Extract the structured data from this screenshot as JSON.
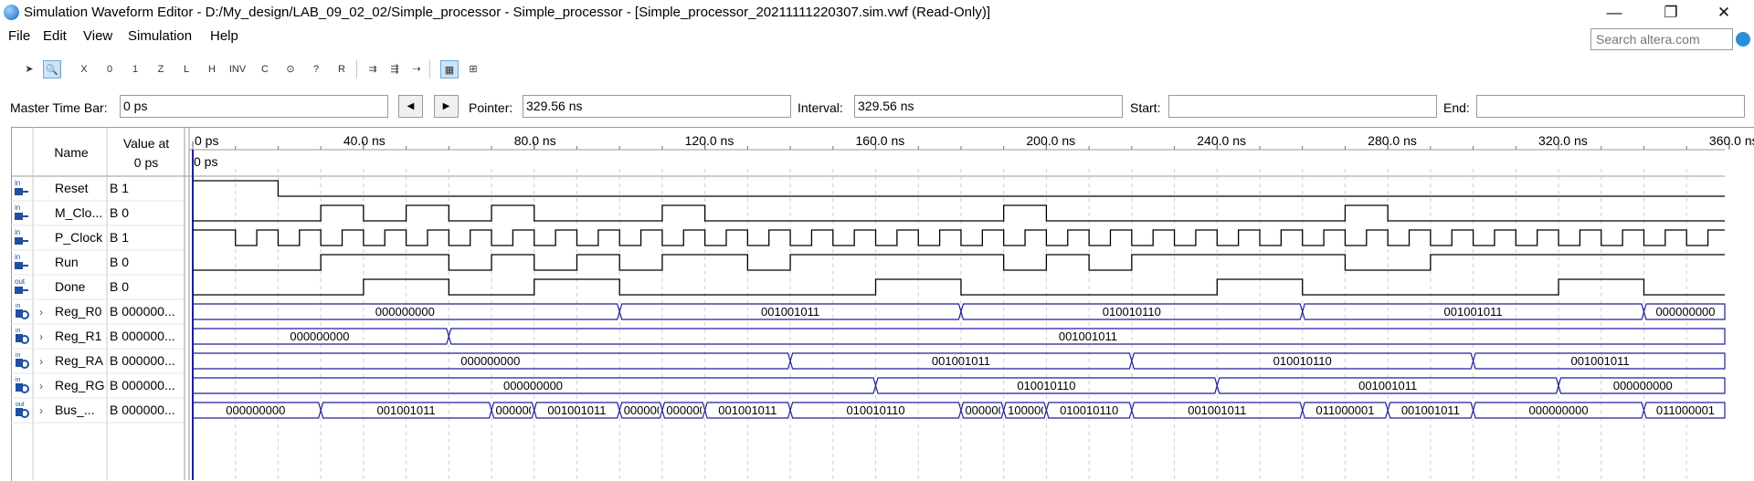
{
  "window": {
    "title": "Simulation Waveform Editor - D:/My_design/LAB_09_02_02/Simple_processor - Simple_processor - [Simple_processor_20211111220307.sim.vwf (Read-Only)]",
    "minimize_glyph": "—",
    "restore_glyph": "❐",
    "close_glyph": "✕"
  },
  "menu": [
    "File",
    "Edit",
    "View",
    "Simulation",
    "Help"
  ],
  "search": {
    "placeholder": "Search altera.com"
  },
  "toolbar": [
    {
      "name": "selection-tool-icon",
      "glyph": "➤"
    },
    {
      "name": "zoom-tool-icon",
      "glyph": "🔍"
    },
    {
      "name": "force-unknown-icon",
      "glyph": "X"
    },
    {
      "name": "force-low-icon",
      "glyph": "0"
    },
    {
      "name": "force-high-icon",
      "glyph": "1"
    },
    {
      "name": "force-high-impedance-icon",
      "glyph": "Z"
    },
    {
      "name": "force-weak-low-icon",
      "glyph": "L"
    },
    {
      "name": "force-weak-high-icon",
      "glyph": "H"
    },
    {
      "name": "invert-icon",
      "glyph": "INV"
    },
    {
      "name": "count-value-icon",
      "glyph": "C"
    },
    {
      "name": "overwrite-clock-icon",
      "glyph": "⊙"
    },
    {
      "name": "arbitrary-value-icon",
      "glyph": "?"
    },
    {
      "name": "random-values-icon",
      "glyph": "R"
    },
    {
      "name": "run-functional-simulation-icon",
      "glyph": "⇉"
    },
    {
      "name": "run-timing-simulation-icon",
      "glyph": "⇶"
    },
    {
      "name": "generate-netlist-icon",
      "glyph": "⇢"
    },
    {
      "name": "snap-to-grid-icon",
      "glyph": "▦"
    },
    {
      "name": "grid-settings-icon",
      "glyph": "⊞"
    }
  ],
  "timebar": {
    "master_label": "Master Time Bar:",
    "master_value": "0 ps",
    "pointer_label": "Pointer:",
    "pointer_value": "329.56 ns",
    "interval_label": "Interval:",
    "interval_value": "329.56 ns",
    "start_label": "Start:",
    "start_value": "",
    "end_label": "End:",
    "end_value": ""
  },
  "columns": {
    "name": "Name",
    "value_at": "Value at",
    "value_at_time": "0 ps"
  },
  "cursor_label": "0 ps",
  "time_axis": {
    "unit": "ns",
    "range": [
      0,
      360
    ],
    "ticks": [
      {
        "t": 0,
        "label": "0 ps"
      },
      {
        "t": 40,
        "label": "40.0 ns"
      },
      {
        "t": 80,
        "label": "80.0 ns"
      },
      {
        "t": 120,
        "label": "120.0 ns"
      },
      {
        "t": 160,
        "label": "160.0 ns"
      },
      {
        "t": 200,
        "label": "200.0 ns"
      },
      {
        "t": 240,
        "label": "240.0 ns"
      },
      {
        "t": 280,
        "label": "280.0 ns"
      },
      {
        "t": 320,
        "label": "320.0 ns"
      },
      {
        "t": 360,
        "label": "360.0 ns"
      }
    ]
  },
  "colors": {
    "bus": "#1f1f9a",
    "grid": "#c8c8c8",
    "input_icon": "#1e4fa0",
    "cursor": "#1f1f9a"
  },
  "signals": [
    {
      "name": "Reset",
      "icon": "in",
      "value": "B 1",
      "type": "bit",
      "edges": [
        0,
        20
      ],
      "initial": 1
    },
    {
      "name": "M_Clo...",
      "icon": "in",
      "value": "B 0",
      "type": "bit",
      "initial": 0,
      "edges": [
        30,
        40,
        50,
        60,
        70,
        80,
        110,
        120,
        190,
        200,
        270,
        280
      ]
    },
    {
      "name": "P_Clock",
      "icon": "in",
      "value": "B 1",
      "type": "bit",
      "initial": 1,
      "edges": [
        10,
        15,
        20,
        25,
        30,
        35,
        40,
        45,
        50,
        55,
        60,
        65,
        70,
        75,
        80,
        85,
        90,
        95,
        100,
        105,
        110,
        115,
        120,
        125,
        130,
        135,
        140,
        145,
        150,
        155,
        160,
        165,
        170,
        175,
        180,
        185,
        190,
        195,
        200,
        205,
        210,
        215,
        220,
        225,
        230,
        235,
        240,
        245,
        250,
        255,
        260,
        265,
        270,
        275,
        280,
        285,
        290,
        295,
        300,
        305,
        310,
        315,
        320,
        325,
        330,
        335,
        340,
        345,
        350,
        355
      ]
    },
    {
      "name": "Run",
      "icon": "in",
      "value": "B 0",
      "type": "bit",
      "initial": 0,
      "edges": [
        30,
        60,
        70,
        80,
        90,
        100,
        110,
        130,
        140,
        190,
        200,
        210,
        220,
        270,
        290
      ]
    },
    {
      "name": "Done",
      "icon": "out",
      "value": "B 0",
      "type": "bit",
      "initial": 0,
      "edges": [
        40,
        60,
        80,
        100,
        160,
        180,
        240,
        260,
        320,
        340
      ]
    },
    {
      "name": "Reg_R0",
      "icon": "bus",
      "value": "B 000000...",
      "type": "bus",
      "segments": [
        [
          0,
          100,
          "000000000"
        ],
        [
          100,
          180,
          "001001011"
        ],
        [
          180,
          260,
          "010010110"
        ],
        [
          260,
          340,
          "001001011"
        ],
        [
          340,
          360,
          "000000000"
        ]
      ]
    },
    {
      "name": "Reg_R1",
      "icon": "bus",
      "value": "B 000000...",
      "type": "bus",
      "segments": [
        [
          0,
          60,
          "000000000"
        ],
        [
          60,
          360,
          "001001011"
        ]
      ]
    },
    {
      "name": "Reg_RA",
      "icon": "bus",
      "value": "B 000000...",
      "type": "bus",
      "segments": [
        [
          0,
          140,
          "000000000"
        ],
        [
          140,
          220,
          "001001011"
        ],
        [
          220,
          300,
          "010010110"
        ],
        [
          300,
          360,
          "001001011"
        ]
      ]
    },
    {
      "name": "Reg_RG",
      "icon": "bus",
      "value": "B 000000...",
      "type": "bus",
      "segments": [
        [
          0,
          160,
          "000000000"
        ],
        [
          160,
          240,
          "010010110"
        ],
        [
          240,
          320,
          "001001011"
        ],
        [
          320,
          360,
          "000000000"
        ]
      ]
    },
    {
      "name": "Bus_...",
      "icon": "out-bus",
      "value": "B 000000...",
      "type": "bus",
      "segments": [
        [
          0,
          30,
          "000000000"
        ],
        [
          30,
          70,
          "001001011"
        ],
        [
          70,
          80,
          "000000000"
        ],
        [
          80,
          100,
          "001001011"
        ],
        [
          100,
          110,
          "000000000"
        ],
        [
          110,
          120,
          "000000000"
        ],
        [
          120,
          140,
          "001001011"
        ],
        [
          140,
          180,
          "010010110"
        ],
        [
          180,
          190,
          "000000000"
        ],
        [
          190,
          200,
          "100000000"
        ],
        [
          200,
          220,
          "010010110"
        ],
        [
          220,
          260,
          "001001011"
        ],
        [
          260,
          280,
          "011000001"
        ],
        [
          280,
          300,
          "001001011"
        ],
        [
          300,
          340,
          "000000000"
        ],
        [
          340,
          360,
          "011000001"
        ]
      ]
    }
  ]
}
